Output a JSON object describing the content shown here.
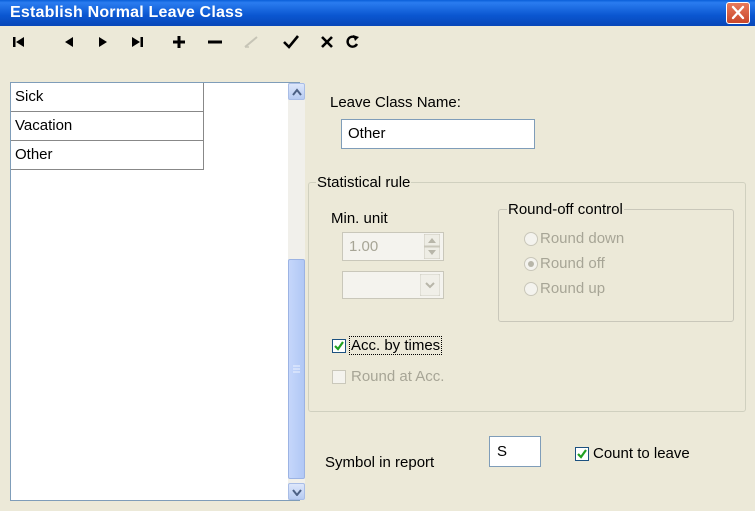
{
  "window": {
    "title": "Establish Normal Leave Class"
  },
  "toolbar": {
    "buttons": [
      {
        "icon": "first-record-icon"
      },
      {
        "icon": "previous-record-icon"
      },
      {
        "icon": "next-record-icon"
      },
      {
        "icon": "last-record-icon"
      },
      {
        "icon": "add-record-icon"
      },
      {
        "icon": "delete-record-icon"
      },
      {
        "icon": "edit-record-icon"
      },
      {
        "icon": "save-check-icon"
      },
      {
        "icon": "cancel-x-icon"
      },
      {
        "icon": "refresh-icon"
      }
    ]
  },
  "list": {
    "items": [
      "Sick",
      "Vacation",
      "Other"
    ]
  },
  "form": {
    "leave_class_name_label": "Leave Class Name:",
    "leave_class_name_value": "Other",
    "statistical_rule_legend": "Statistical rule",
    "min_unit_label": "Min. unit",
    "min_unit_value": "1.00",
    "round_off_legend": "Round-off control",
    "round_down": "Round down",
    "round_off": "Round off",
    "round_up": "Round up",
    "round_selected": "Round off",
    "acc_by_times": "Acc. by times",
    "acc_by_times_checked": true,
    "round_at_acc": "Round at Acc.",
    "round_at_acc_checked": false,
    "symbol_label": "Symbol in report",
    "symbol_value": "S",
    "count_to_leave": "Count to leave",
    "count_to_leave_checked": true
  },
  "colors": {
    "title_bar": "#0a56d0",
    "face": "#ece9d8",
    "disabled_text": "#a7a596",
    "check": "#21a121"
  }
}
